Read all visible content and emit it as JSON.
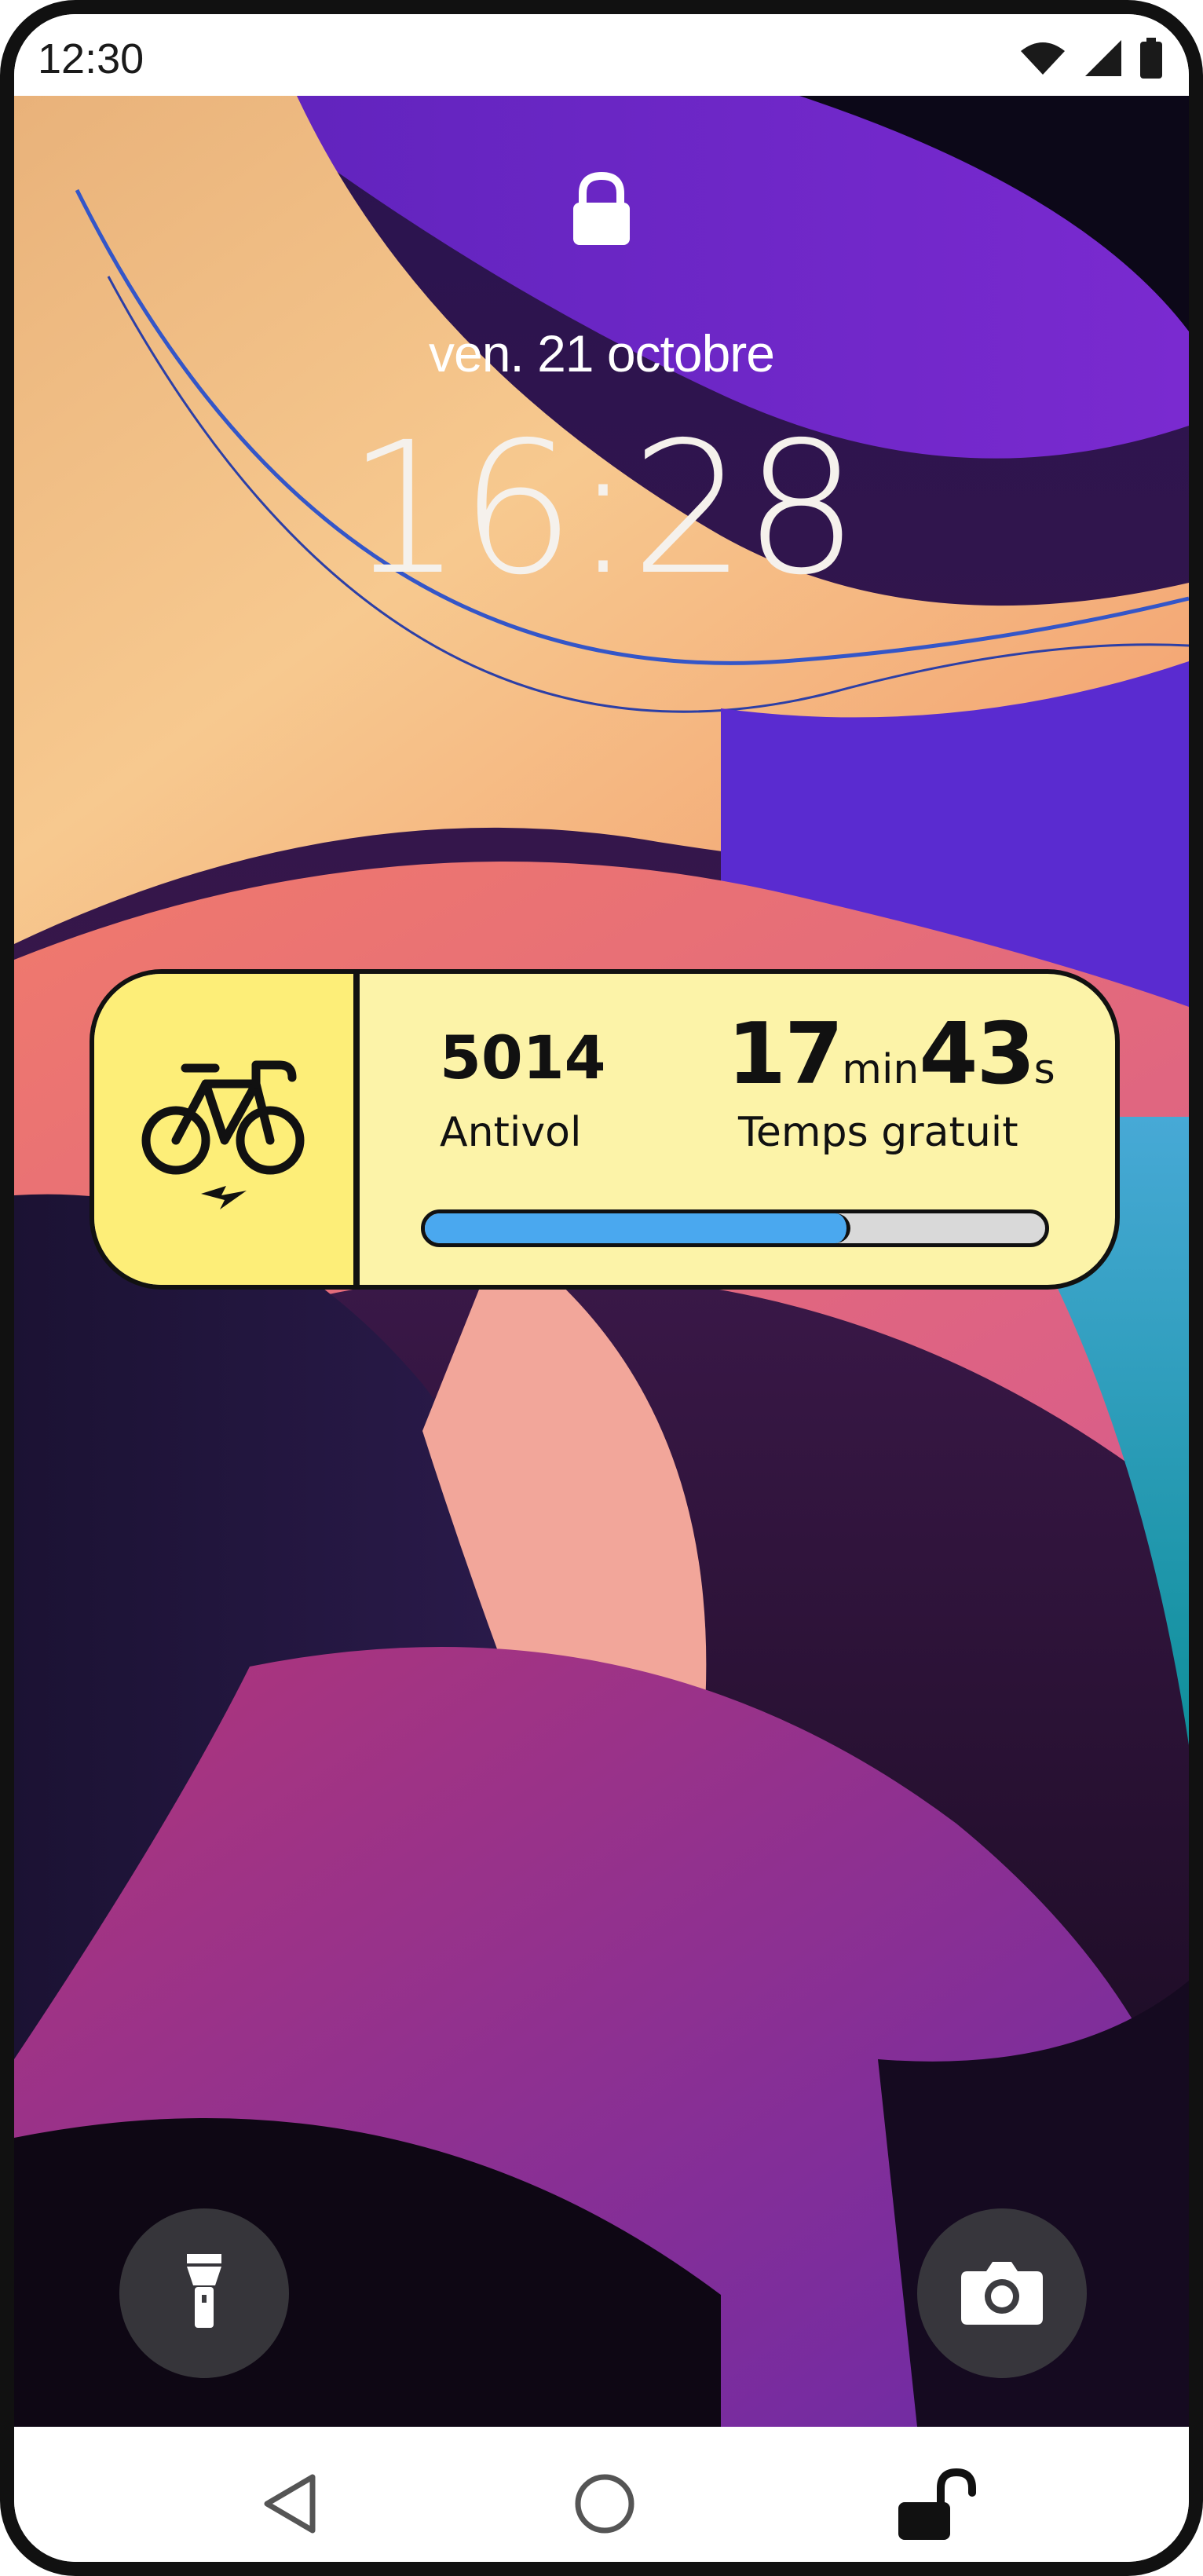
{
  "status_bar": {
    "time": "12:30",
    "icons": [
      "wifi-icon",
      "cell-signal-icon",
      "battery-icon"
    ]
  },
  "lock_screen": {
    "lock_icon": "padlock-icon",
    "date": "ven. 21 octobre",
    "clock": "16:28"
  },
  "widget": {
    "icon": "electric-bike-icon",
    "lock_code": "5014",
    "lock_code_label": "Antivol",
    "timer_minutes": "17",
    "timer_minutes_unit": "min",
    "timer_seconds": "43",
    "timer_seconds_unit": "s",
    "timer_label": "Temps gratuit",
    "progress_fraction": 0.68
  },
  "quick_actions": {
    "left": "flashlight-icon",
    "right": "camera-icon"
  },
  "nav_bar": {
    "back": "back-triangle-icon",
    "home": "home-circle-icon",
    "unlock": "unlocked-padlock-icon"
  },
  "colors": {
    "widget_bg": "#fcf3a8",
    "widget_icon_bg": "#fdee78",
    "progress_fill": "#4aa8ef",
    "progress_track": "#d9d9d9",
    "outline": "#111111"
  }
}
